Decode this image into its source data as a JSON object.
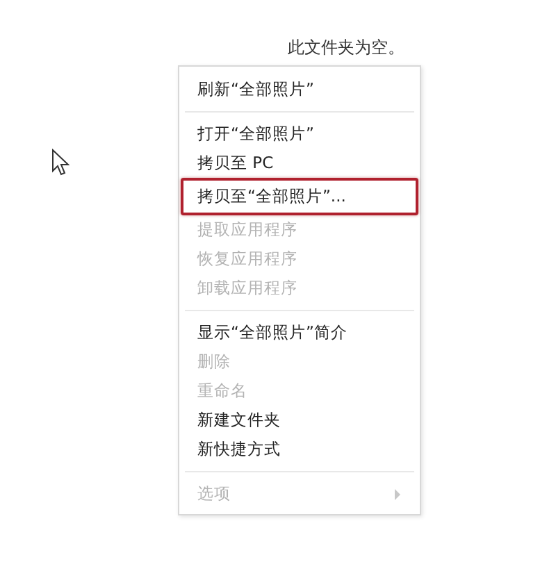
{
  "empty_message": "此文件夹为空。",
  "context_menu": {
    "items": [
      {
        "kind": "item",
        "label": "刷新“全部照片”",
        "disabled": false,
        "selected": false
      },
      {
        "kind": "separator"
      },
      {
        "kind": "item",
        "label": "打开“全部照片”",
        "disabled": false,
        "selected": false
      },
      {
        "kind": "item",
        "label": "拷贝至 PC",
        "disabled": false,
        "selected": false
      },
      {
        "kind": "item",
        "label": "拷贝至“全部照片”...",
        "disabled": false,
        "selected": true
      },
      {
        "kind": "item",
        "label": "提取应用程序",
        "disabled": true,
        "selected": false
      },
      {
        "kind": "item",
        "label": "恢复应用程序",
        "disabled": true,
        "selected": false
      },
      {
        "kind": "item",
        "label": "卸载应用程序",
        "disabled": true,
        "selected": false
      },
      {
        "kind": "separator"
      },
      {
        "kind": "item",
        "label": "显示“全部照片”简介",
        "disabled": false,
        "selected": false
      },
      {
        "kind": "item",
        "label": "删除",
        "disabled": true,
        "selected": false
      },
      {
        "kind": "item",
        "label": "重命名",
        "disabled": true,
        "selected": false
      },
      {
        "kind": "item",
        "label": "新建文件夹",
        "disabled": false,
        "selected": false
      },
      {
        "kind": "item",
        "label": "新快捷方式",
        "disabled": false,
        "selected": false
      },
      {
        "kind": "separator"
      },
      {
        "kind": "submenu",
        "label": "选项",
        "disabled": true,
        "selected": false
      }
    ]
  }
}
